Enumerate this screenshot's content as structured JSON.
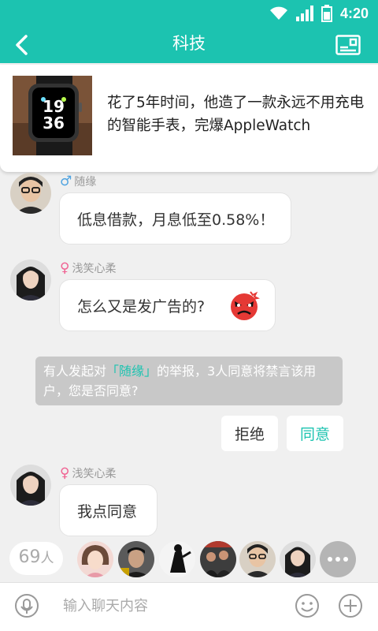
{
  "status_bar": {
    "time": "4:20"
  },
  "header": {
    "title": "科技"
  },
  "news": {
    "title": "花了5年时间，他造了一款永远不用充电的智能手表，完爆AppleWatch",
    "thumb_time_hour": "19",
    "thumb_time_min": "36"
  },
  "messages": [
    {
      "username": "随缘",
      "gender": "♂",
      "text": "低息借款，月息低至0.58%！"
    },
    {
      "username": "浅笑心柔",
      "gender": "♀",
      "text": "怎么又是发广告的?"
    },
    {
      "username": "浅笑心柔",
      "gender": "♀",
      "text": "我点同意"
    }
  ],
  "system_notice": {
    "prefix": "有人发起对",
    "highlight": "「随缘」",
    "suffix": "的举报，3人同意将禁言该用户，您是否同意?"
  },
  "actions": {
    "reject": "拒绝",
    "agree": "同意"
  },
  "members": {
    "count": "69",
    "unit": "人"
  },
  "input": {
    "placeholder": "输入聊天内容"
  },
  "colors": {
    "accent": "#1cc3b0",
    "male": "#4fa3e0",
    "female": "#f06292",
    "system_bg": "#c8c8c8"
  },
  "icons": [
    "back-arrow-icon",
    "news-card-icon",
    "wifi-icon",
    "signal-icon",
    "battery-icon",
    "angry-emoji-icon",
    "voice-icon",
    "emoji-icon",
    "plus-icon",
    "more-icon"
  ]
}
